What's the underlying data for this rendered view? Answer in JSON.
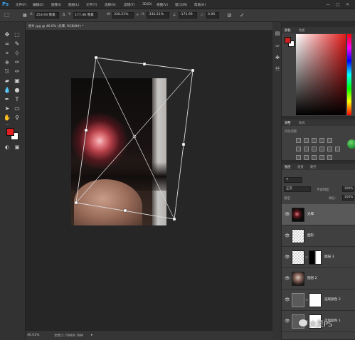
{
  "app": {
    "logo": "Ps"
  },
  "menu": {
    "items": [
      "文件(F)",
      "编辑(E)",
      "图像(I)",
      "图层(L)",
      "文字(Y)",
      "选择(S)",
      "滤镜(T)",
      "3D(D)",
      "视图(V)",
      "窗口(W)",
      "帮助(H)"
    ]
  },
  "options": {
    "x_label": "X:",
    "x_value": "253.93 像素",
    "y_label": "Y:",
    "y_value": "177.48 像素",
    "w_label": "W:",
    "w_value": "330.21%",
    "h_label": "H:",
    "h_value": "-330.21%",
    "angle_value": "-171.99",
    "h_skew": "0.00",
    "cancel_icon": "cancel-icon",
    "commit_icon": "commit-checkmark-icon"
  },
  "document": {
    "tab_label": "原片.jpg @ 46.6% (光晕, RGB/8#) *",
    "zoom": "46.62%",
    "doc_info": "文档:1.70M/9.79M"
  },
  "colors": {
    "foreground": "#e02020",
    "background": "#ffffff",
    "selected_color": "#cc1f1f"
  },
  "panels": {
    "color_tabs": [
      "颜色",
      "色板"
    ],
    "adjust_tabs": [
      "调整",
      "样式"
    ],
    "adjust_label": "添加调整",
    "layer_tabs": [
      "图层",
      "通道",
      "路径"
    ],
    "blend_mode": "正常",
    "opacity_label": "不透明度:",
    "opacity_value": "100%",
    "lock_label": "锁定:",
    "fill_label": "填充:",
    "fill_value": "100%"
  },
  "layers": [
    {
      "name": "光晕",
      "selected": true,
      "thumb": "dark-with-glow"
    },
    {
      "name": "图形",
      "selected": false,
      "thumb": "checker"
    },
    {
      "name": "图层 3",
      "selected": false,
      "thumb": "checker-mask"
    },
    {
      "name": "图层 2",
      "selected": false,
      "thumb": "portrait"
    },
    {
      "name": "选取颜色 2",
      "selected": false,
      "thumb": "adjustment-mask"
    },
    {
      "name": "选取颜色 1",
      "selected": false,
      "thumb": "adjustment-mask"
    }
  ],
  "watermark": "火灵PS"
}
